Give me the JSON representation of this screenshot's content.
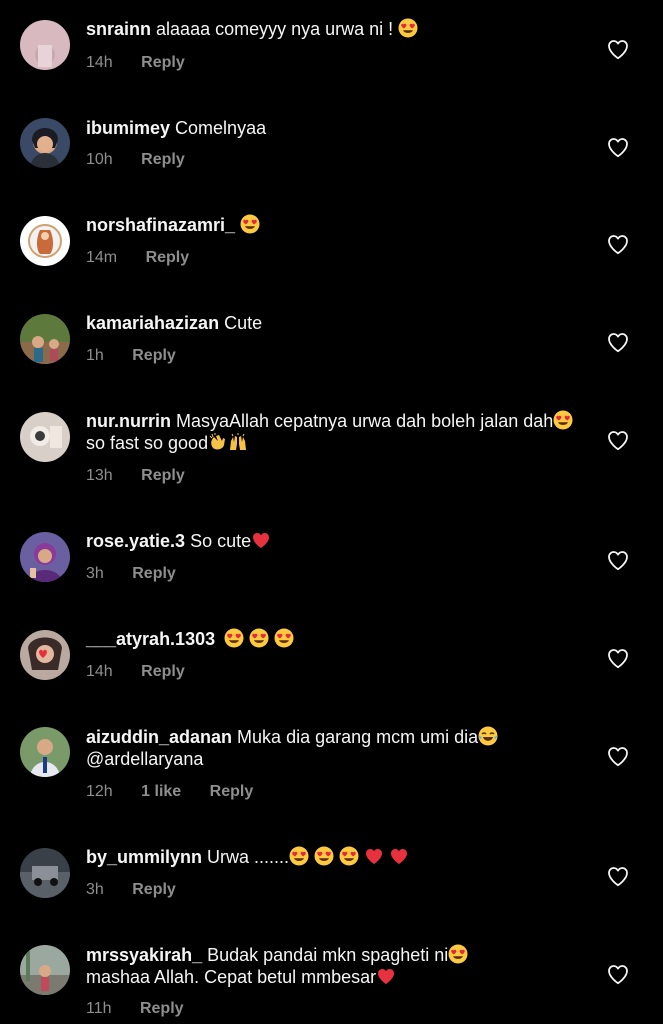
{
  "comments": [
    {
      "username": "snrainn",
      "text": "alaaaa comeyyy nya urwa ni !",
      "emoji_suffix": "heart-eyes",
      "time": "14h",
      "likes": "",
      "reply": "Reply"
    },
    {
      "username": "ibumimey",
      "text": "Comelnyaa",
      "time": "10h",
      "likes": "",
      "reply": "Reply"
    },
    {
      "username": "norshafinazamri_",
      "text": "",
      "emoji_suffix": "heart-eyes",
      "time": "14m",
      "likes": "",
      "reply": "Reply"
    },
    {
      "username": "kamariahazizan",
      "text": "Cute",
      "time": "1h",
      "likes": "",
      "reply": "Reply"
    },
    {
      "username": "nur.nurrin",
      "text": "MasyaAllah cepatnya urwa dah boleh jalan dah",
      "text2": "so fast so good",
      "time": "13h",
      "likes": "",
      "reply": "Reply"
    },
    {
      "username": "rose.yatie.3",
      "text": "So cute",
      "time": "3h",
      "likes": "",
      "reply": "Reply"
    },
    {
      "username": "___atyrah.1303",
      "text": "",
      "time": "14h",
      "likes": "",
      "reply": "Reply"
    },
    {
      "username": "aizuddin_adanan",
      "text": "Muka dia garang mcm umi dia",
      "mention": "@ardellaryana",
      "time": "12h",
      "likes": "1 like",
      "reply": "Reply"
    },
    {
      "username": "by_ummilynn",
      "text": "Urwa .......",
      "time": "3h",
      "likes": "",
      "reply": "Reply"
    },
    {
      "username": "mrssyakirah_",
      "text": "Budak pandai mkn spagheti ni",
      "text2": "mashaa Allah. Cepat betul mmbesar",
      "time": "11h",
      "likes": "",
      "reply": "Reply"
    }
  ],
  "icons": {
    "like": "heart-outline-icon",
    "heart_eyes": "heart-eyes-emoji",
    "red_heart": "red-heart-emoji",
    "clap": "clapping-hands-emoji",
    "raised_hands": "raising-hands-emoji",
    "tears_of_joy": "tears-of-joy-emoji"
  },
  "colors": {
    "background": "#000000",
    "text": "#f5f5f5",
    "meta": "#8e8e8e",
    "heart": "#ed4956"
  }
}
